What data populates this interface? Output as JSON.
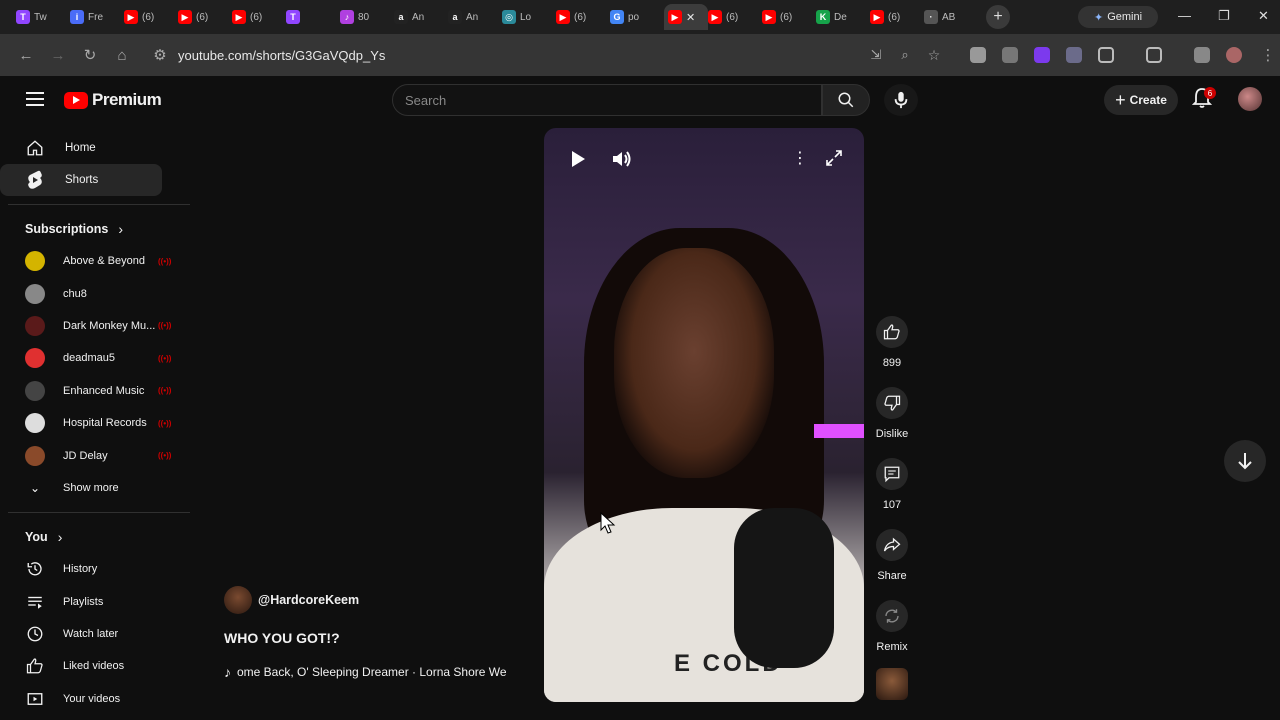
{
  "browser": {
    "tabs": [
      {
        "label": "Tw",
        "color": "#9146ff",
        "glyph": "T"
      },
      {
        "label": "Fre",
        "color": "#4a6cf7",
        "glyph": "i"
      },
      {
        "label": "(6)",
        "color": "#ff0000",
        "glyph": "▶"
      },
      {
        "label": "(6)",
        "color": "#ff0000",
        "glyph": "▶"
      },
      {
        "label": "(6)",
        "color": "#ff0000",
        "glyph": "▶"
      },
      {
        "label": "",
        "color": "#9146ff",
        "glyph": "T"
      },
      {
        "label": "80",
        "color": "#b040e0",
        "glyph": "♪"
      },
      {
        "label": "An",
        "color": "#222222",
        "glyph": "a"
      },
      {
        "label": "An",
        "color": "#222222",
        "glyph": "a"
      },
      {
        "label": "Lo",
        "color": "#2a8a9a",
        "glyph": "◎"
      },
      {
        "label": "(6)",
        "color": "#ff0000",
        "glyph": "▶"
      },
      {
        "label": "po",
        "color": "#4285f4",
        "glyph": "G"
      }
    ],
    "active_tab_close": "✕",
    "tabs_after": [
      {
        "label": "(6)",
        "color": "#ff0000",
        "glyph": "▶"
      },
      {
        "label": "(6)",
        "color": "#ff0000",
        "glyph": "▶"
      },
      {
        "label": "De",
        "color": "#16a34a",
        "glyph": "K"
      },
      {
        "label": "(6)",
        "color": "#ff0000",
        "glyph": "▶"
      },
      {
        "label": "AB",
        "color": "#555555",
        "glyph": "·"
      }
    ],
    "new_tab": "+",
    "gemini_label": "Gemini",
    "url": "youtube.com/shorts/G3GaVQdp_Ys"
  },
  "header": {
    "logo_text": "Premium",
    "search_placeholder": "Search",
    "create_label": "Create",
    "notification_count": "6"
  },
  "sidebar": {
    "home": "Home",
    "shorts": "Shorts",
    "subscriptions_title": "Subscriptions",
    "subscriptions": [
      {
        "name": "Above & Beyond",
        "live": true,
        "color": "#d4b400"
      },
      {
        "name": "chu8",
        "live": false,
        "color": "#888888"
      },
      {
        "name": "Dark Monkey Mu...",
        "live": true,
        "color": "#5a1a1a"
      },
      {
        "name": "deadmau5",
        "live": true,
        "color": "#e03030"
      },
      {
        "name": "Enhanced Music",
        "live": true,
        "color": "#444444"
      },
      {
        "name": "Hospital Records",
        "live": true,
        "color": "#dddddd"
      },
      {
        "name": "JD Delay",
        "live": true,
        "color": "#8a4a2a"
      }
    ],
    "show_more": "Show more",
    "you_title": "You",
    "you_items": [
      {
        "label": "History",
        "icon": "history-icon"
      },
      {
        "label": "Playlists",
        "icon": "playlists-icon"
      },
      {
        "label": "Watch later",
        "icon": "watch-later-icon"
      },
      {
        "label": "Liked videos",
        "icon": "liked-videos-icon"
      },
      {
        "label": "Your videos",
        "icon": "your-videos-icon"
      }
    ]
  },
  "short": {
    "channel": "@HardcoreKeem",
    "title": "WHO YOU GOT!?",
    "music": "ome Back, O' Sleeping Dreamer · Lorna Shore   We",
    "shirt_text": "E COLD",
    "likes": "899",
    "dislike_label": "Dislike",
    "comments": "107",
    "share_label": "Share",
    "remix_label": "Remix"
  }
}
